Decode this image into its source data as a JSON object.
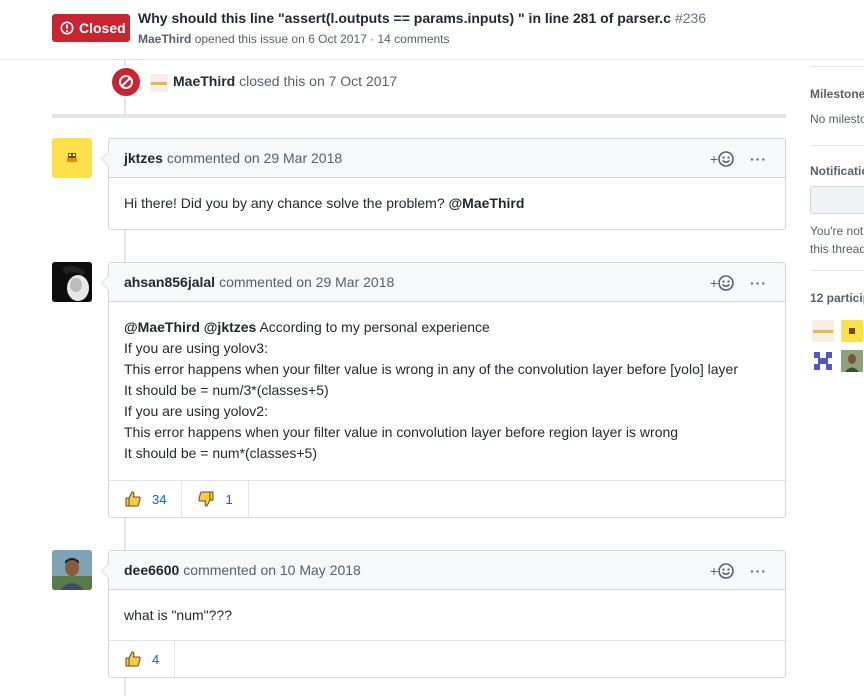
{
  "issue": {
    "state_label": "Closed",
    "title": "Why should this line \"assert(l.outputs == params.inputs) \" in line 281 of parser.c",
    "number": "#236",
    "author": "MaeThird",
    "meta_text": "opened this issue on 6 Oct 2017 · 14 comments"
  },
  "closed_event": {
    "actor": "MaeThird",
    "text": "closed this on 7 Oct 2017"
  },
  "comments": [
    {
      "author": "jktzes",
      "action": "commented",
      "timestamp": "on 29 Mar 2018",
      "body": {
        "text": "Hi there! Did you by any chance solve the problem?",
        "mention": "@MaeThird"
      }
    },
    {
      "author": "ahsan856jalal",
      "action": "commented",
      "timestamp": "on 29 Mar 2018",
      "body": {
        "mention1": "@MaeThird",
        "mention2": "@jktzes",
        "line1_rest": "According to my personal experience",
        "line2": "If you are using yolov3:",
        "line3": "This error happens when your filter value is wrong in any of the convolution layer before [yolo] layer",
        "line4": "It should be = num/3*(classes+5)",
        "line5": "If you are using yolov2:",
        "line6": "This error happens when your filter value in convolution layer before region layer is wrong",
        "line7": "It should be = num*(classes+5)"
      },
      "reactions": {
        "thumbs_up": "34",
        "thumbs_down": "1"
      }
    },
    {
      "author": "dee6600",
      "action": "commented",
      "timestamp": "on 10 May 2018",
      "body": {
        "text": "what is \"num\"???"
      },
      "reactions": {
        "thumbs_up": "4"
      }
    }
  ],
  "header_actions": {
    "add_reaction": "+",
    "more": "···"
  },
  "sidebar": {
    "milestone_heading": "Milestone",
    "milestone_value": "No milesto",
    "notifications_heading": "Notificatio",
    "notifications_line1": "You're not",
    "notifications_line2": "this thread",
    "participants_heading": "12 particip"
  },
  "colors": {
    "closed_red": "#cb2431",
    "link_blue": "#0366d6",
    "border": "#d1d5da",
    "header_bg": "#f6f8fa"
  }
}
